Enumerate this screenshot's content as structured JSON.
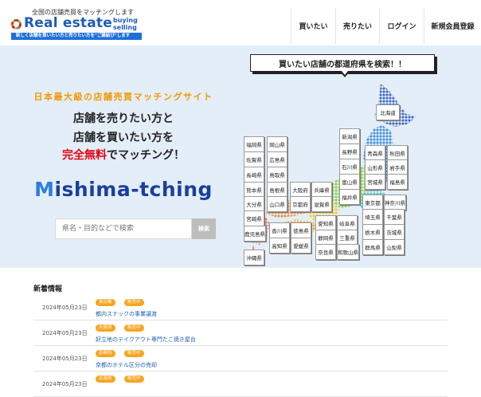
{
  "header": {
    "tagline": "全国の店舗売買をマッチングします",
    "logo": {
      "main": "Real estate",
      "sub": "buying\nselling",
      "bar": "新しく店舗を買いたい方と売りたい方を\"ご縁結び\"します"
    },
    "nav": [
      "買いたい",
      "売りたい",
      "ログイン",
      "新規会員登録"
    ]
  },
  "hero": {
    "kicker": "日本最大級の店舗売買マッチングサイト",
    "lead1": "店舗を売りたい方と",
    "lead2": "店舗を買いたい方を",
    "lead3_highlight": "完全無料",
    "lead3_rest": "でマッチング！",
    "brand_first": "M",
    "brand_rest": "ishima-tching",
    "search_placeholder": "県名・目的などで検索",
    "search_button": "検索"
  },
  "map": {
    "title": "買いたい店舗の都道府県を検索！！",
    "prefectures": [
      "北海道",
      "青森県",
      "秋田県",
      "岩手県",
      "山形県",
      "宮城県",
      "福島県",
      "新潟県",
      "長野県",
      "石川県",
      "富山県",
      "福井県",
      "東京都",
      "神奈川県",
      "埼玉県",
      "千葉県",
      "栃木県",
      "茨城県",
      "群馬県",
      "山梨県",
      "愛知県",
      "岐阜県",
      "静岡県",
      "三重県",
      "奈良県",
      "和歌山県",
      "大阪府",
      "兵庫県",
      "京都府",
      "滋賀県",
      "香川県",
      "徳島県",
      "高知県",
      "愛媛県",
      "福岡県",
      "岡山県",
      "佐賀県",
      "広島県",
      "長崎県",
      "鳥取県",
      "熊本県",
      "島根県",
      "大分県",
      "山口県",
      "宮崎県",
      "鹿児島県",
      "沖縄県"
    ],
    "colors": {
      "hokkaido": "#3a66c9",
      "tohoku": "#3f8fdc",
      "chubu": "#8fcf3d",
      "kanto": "#55c7c2",
      "kinki": "#f2cd2e",
      "shikoku": "#f5a623",
      "chugoku": "#f08a3a",
      "kyushu": "#e86a4a"
    }
  },
  "news": {
    "heading": "新着情報",
    "items": [
      {
        "date": "2024年05月23日",
        "area": "東京都",
        "status": "販売中",
        "title": "都内スナックの事業譲渡"
      },
      {
        "date": "2024年05月23日",
        "area": "大阪府",
        "status": "販売中",
        "title": "好立地のテイクアウト専門たこ焼き屋台"
      },
      {
        "date": "2024年05月23日",
        "area": "京都府",
        "status": "販売中",
        "title": "京都のホテル区分の売却"
      },
      {
        "date": "2024年05月23日",
        "area": "広島県",
        "status": "販売中",
        "title": ""
      }
    ]
  }
}
